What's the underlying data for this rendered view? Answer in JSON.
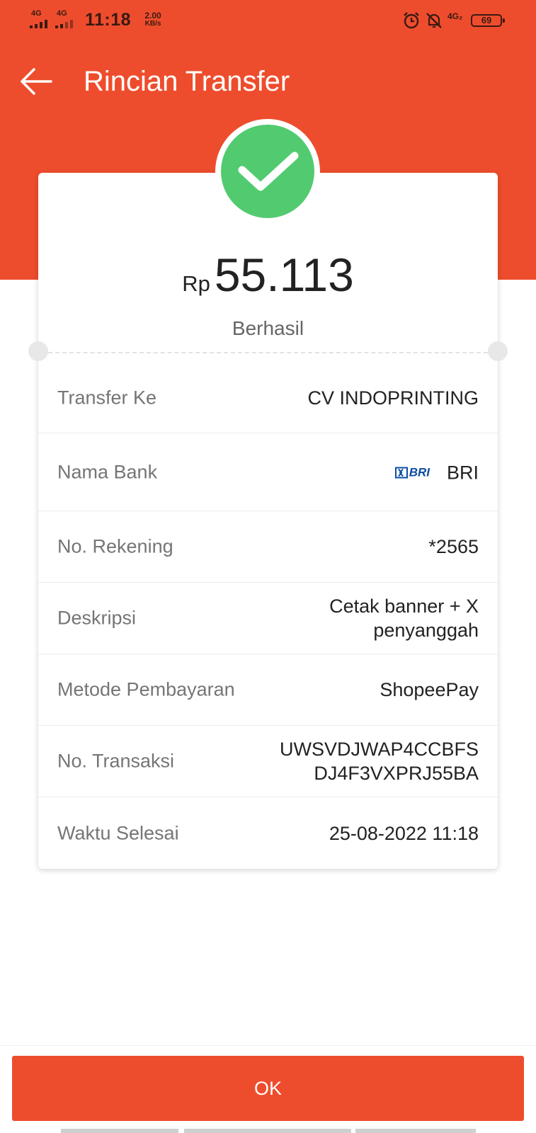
{
  "status_bar": {
    "network_1": "4G",
    "network_2": "4G",
    "time": "11:18",
    "speed_value": "2.00",
    "speed_unit": "KB/s",
    "network_right": "4G₂",
    "battery": "69",
    "icons": [
      "alarm-icon",
      "notifications-off-icon"
    ]
  },
  "header": {
    "title": "Rincian Transfer",
    "back_icon": "arrow-left-icon"
  },
  "summary": {
    "currency": "Rp",
    "amount": "55.113",
    "status": "Berhasil",
    "status_icon": "check-icon"
  },
  "details": [
    {
      "label": "Transfer Ke",
      "value": "CV INDOPRINTING"
    },
    {
      "label": "Nama Bank",
      "value": "BRI",
      "logo_text": "BRI"
    },
    {
      "label": "No. Rekening",
      "value": "*2565"
    },
    {
      "label": "Deskripsi",
      "value": "Cetak banner + X penyanggah"
    },
    {
      "label": "Metode Pembayaran",
      "value": "ShopeePay"
    },
    {
      "label": "No. Transaksi",
      "value": "UWSVDJWAP4CCBFS DJ4F3VXPRJ55BA"
    },
    {
      "label": "Waktu Selesai",
      "value": "25-08-2022 11:18"
    }
  ],
  "footer": {
    "ok_label": "OK"
  },
  "colors": {
    "primary": "#EE4D2D",
    "success": "#52CB70",
    "bank_logo": "#0D4DA1"
  }
}
